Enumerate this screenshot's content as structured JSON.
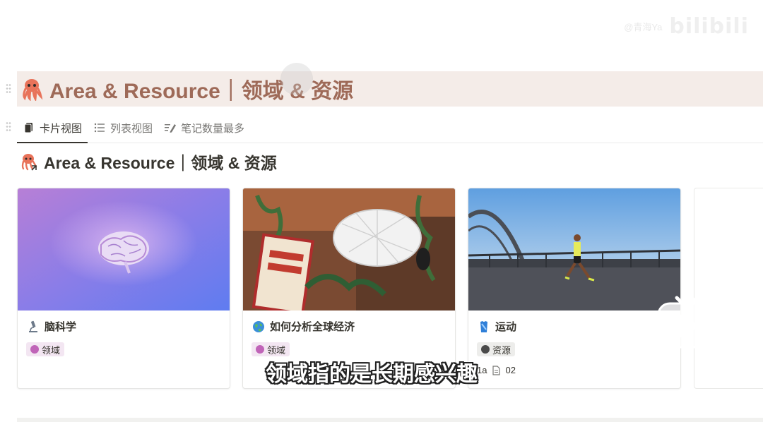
{
  "watermark": {
    "handle": "@青海Ya",
    "logo": "bilibili"
  },
  "page": {
    "title": "Area & Resource｜领域 & 资源"
  },
  "tabs": [
    {
      "label": "卡片视图",
      "icon": "card-icon",
      "active": true
    },
    {
      "label": "列表视图",
      "icon": "list-icon",
      "active": false
    },
    {
      "label": "笔记数量最多",
      "icon": "edit-list-icon",
      "active": false
    }
  ],
  "section": {
    "title": "Area & Resource｜领域 & 资源"
  },
  "cards": [
    {
      "name": "脑科学",
      "icon": "microscope-icon",
      "tag": "领域",
      "tag_bg": "#f3e6f2",
      "tag_dot": "#c064b8"
    },
    {
      "name": "如何分析全球经济",
      "icon": "globe-icon",
      "tag": "领域",
      "tag_bg": "#f3e6f2",
      "tag_dot": "#c064b8"
    },
    {
      "name": "运动",
      "icon": "jersey-icon",
      "tag": "资源",
      "tag_bg": "#ededeb",
      "tag_dot": "#4a4a4a",
      "meta_prefix": "1a",
      "meta_count": "02"
    }
  ],
  "subtitle": "领域指的是长期感兴趣",
  "colors": {
    "title_text": "#9e6a58",
    "title_bg": "#f4ece8",
    "accent_text": "#37352f"
  }
}
